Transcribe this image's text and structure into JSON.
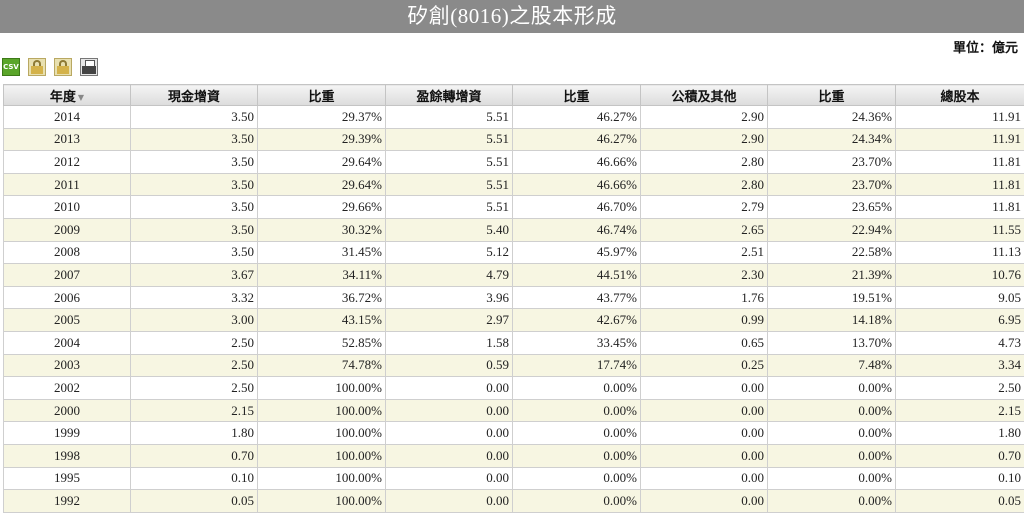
{
  "title": "矽創(8016)之股本形成",
  "unit_label": "單位：億元",
  "toolbar": {
    "csv_label": "CSV",
    "icons": [
      "csv-icon",
      "lock-icon",
      "lock-icon",
      "printer-icon"
    ]
  },
  "table": {
    "sort_indicator": "▼",
    "headers": [
      "年度",
      "現金增資",
      "比重",
      "盈餘轉增資",
      "比重",
      "公積及其他",
      "比重",
      "總股本"
    ],
    "rows": [
      [
        "2014",
        "3.50",
        "29.37%",
        "5.51",
        "46.27%",
        "2.90",
        "24.36%",
        "11.91"
      ],
      [
        "2013",
        "3.50",
        "29.39%",
        "5.51",
        "46.27%",
        "2.90",
        "24.34%",
        "11.91"
      ],
      [
        "2012",
        "3.50",
        "29.64%",
        "5.51",
        "46.66%",
        "2.80",
        "23.70%",
        "11.81"
      ],
      [
        "2011",
        "3.50",
        "29.64%",
        "5.51",
        "46.66%",
        "2.80",
        "23.70%",
        "11.81"
      ],
      [
        "2010",
        "3.50",
        "29.66%",
        "5.51",
        "46.70%",
        "2.79",
        "23.65%",
        "11.81"
      ],
      [
        "2009",
        "3.50",
        "30.32%",
        "5.40",
        "46.74%",
        "2.65",
        "22.94%",
        "11.55"
      ],
      [
        "2008",
        "3.50",
        "31.45%",
        "5.12",
        "45.97%",
        "2.51",
        "22.58%",
        "11.13"
      ],
      [
        "2007",
        "3.67",
        "34.11%",
        "4.79",
        "44.51%",
        "2.30",
        "21.39%",
        "10.76"
      ],
      [
        "2006",
        "3.32",
        "36.72%",
        "3.96",
        "43.77%",
        "1.76",
        "19.51%",
        "9.05"
      ],
      [
        "2005",
        "3.00",
        "43.15%",
        "2.97",
        "42.67%",
        "0.99",
        "14.18%",
        "6.95"
      ],
      [
        "2004",
        "2.50",
        "52.85%",
        "1.58",
        "33.45%",
        "0.65",
        "13.70%",
        "4.73"
      ],
      [
        "2003",
        "2.50",
        "74.78%",
        "0.59",
        "17.74%",
        "0.25",
        "7.48%",
        "3.34"
      ],
      [
        "2002",
        "2.50",
        "100.00%",
        "0.00",
        "0.00%",
        "0.00",
        "0.00%",
        "2.50"
      ],
      [
        "2000",
        "2.15",
        "100.00%",
        "0.00",
        "0.00%",
        "0.00",
        "0.00%",
        "2.15"
      ],
      [
        "1999",
        "1.80",
        "100.00%",
        "0.00",
        "0.00%",
        "0.00",
        "0.00%",
        "1.80"
      ],
      [
        "1998",
        "0.70",
        "100.00%",
        "0.00",
        "0.00%",
        "0.00",
        "0.00%",
        "0.70"
      ],
      [
        "1995",
        "0.10",
        "100.00%",
        "0.00",
        "0.00%",
        "0.00",
        "0.00%",
        "0.10"
      ],
      [
        "1992",
        "0.05",
        "100.00%",
        "0.00",
        "0.00%",
        "0.00",
        "0.00%",
        "0.05"
      ]
    ]
  },
  "colors": {
    "title_bar": "#8a8a8a",
    "row_alt": "#f7f6e2",
    "csv_button": "#5aa52a"
  }
}
